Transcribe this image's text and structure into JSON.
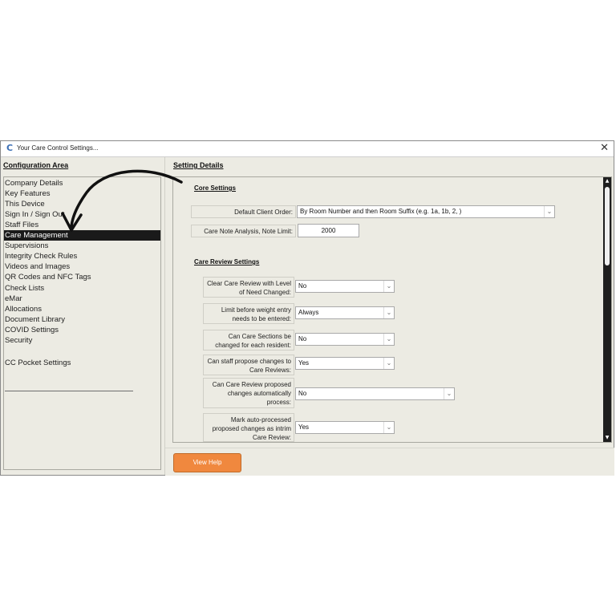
{
  "window": {
    "title": "Your Care Control Settings...",
    "app_icon": "C",
    "close_glyph": "✕"
  },
  "left": {
    "header": "Configuration Area",
    "items": [
      "Company Details",
      "Key Features",
      "This Device",
      "Sign In / Sign Out",
      "Staff Files",
      "Care Management",
      "Supervisions",
      "Integrity Check Rules",
      "Videos and Images",
      "QR Codes and NFC Tags",
      "Check Lists",
      "eMar",
      "Allocations",
      "Document Library",
      "COVID Settings",
      "Security"
    ],
    "selected_index": 5,
    "extra_item": "CC Pocket Settings"
  },
  "right": {
    "header": "Setting Details",
    "core": {
      "title": "Core Settings",
      "default_client_order_label": "Default Client Order:",
      "default_client_order_value": "By Room Number and then Room Suffix (e.g. 1a, 1b, 2, )",
      "note_limit_label": "Care Note Analysis, Note Limit:",
      "note_limit_value": "2000"
    },
    "review": {
      "title": "Care Review Settings",
      "fields": [
        {
          "label": "Clear Care Review with Level of Need Changed:",
          "value": "No"
        },
        {
          "label": "Limit before weight entry needs to be entered:",
          "value": "Always"
        },
        {
          "label": "Can Care Sections be changed for each resident:",
          "value": "No"
        },
        {
          "label": "Can staff propose changes to Care Reviews:",
          "value": "Yes"
        },
        {
          "label": "Can Care Review proposed changes automatically process:",
          "value": "No"
        },
        {
          "label": "Mark auto-processed proposed changes as intrim Care Review:",
          "value": "Yes"
        }
      ]
    }
  },
  "footer": {
    "view_help": "View Help"
  },
  "icons": {
    "dropdown": "chevron-down-icon",
    "scroll_up": "▲",
    "scroll_down": "▼"
  },
  "colors": {
    "accent_button": "#f0883e",
    "selected_bg": "#1a1a1a",
    "panel_bg": "#ecebe3"
  }
}
